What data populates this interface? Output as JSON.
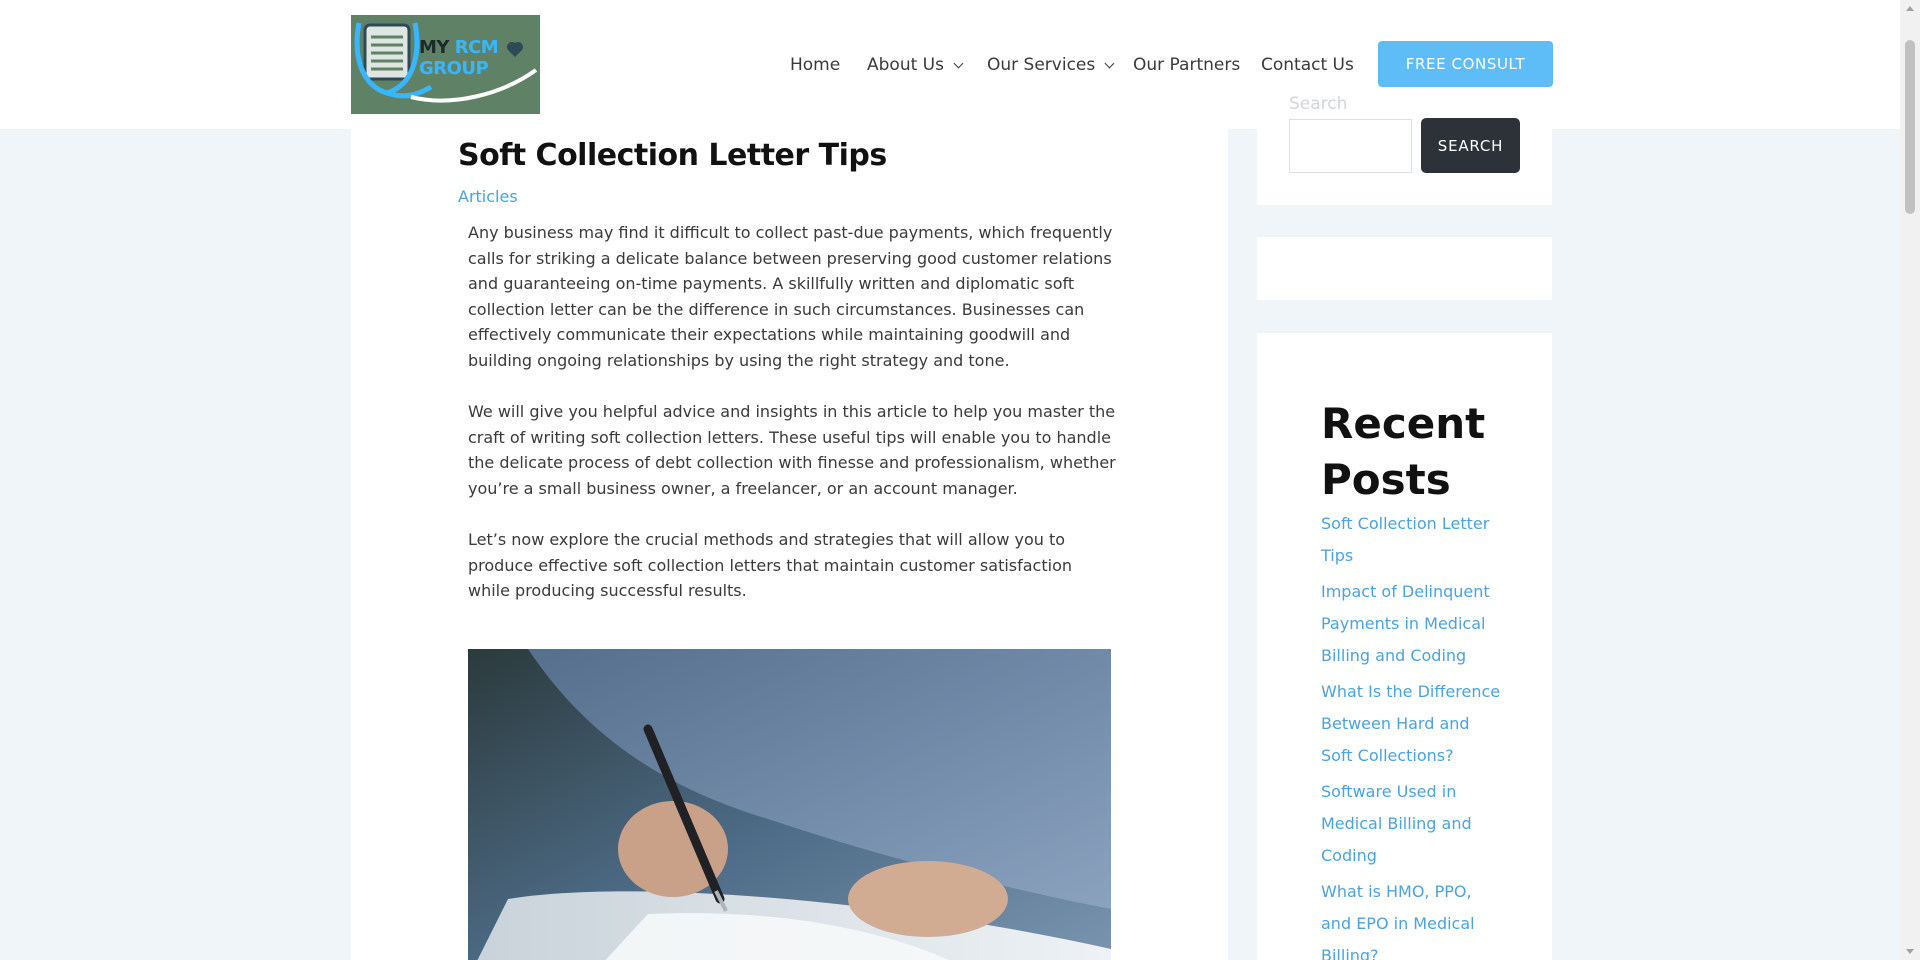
{
  "header": {
    "logo": {
      "line1_a": "MY",
      "line1_b": "RCM",
      "line2": "GROUP"
    },
    "nav": [
      {
        "label": "Home",
        "has_dropdown": false
      },
      {
        "label": "About Us",
        "has_dropdown": true
      },
      {
        "label": "Our Services",
        "has_dropdown": true
      },
      {
        "label": "Our Partners",
        "has_dropdown": false
      },
      {
        "label": "Contact Us",
        "has_dropdown": false
      }
    ],
    "cta_label": "FREE CONSULT",
    "cta_color": "#5ebdf6"
  },
  "article": {
    "title": "Soft Collection Letter Tips",
    "category": "Articles",
    "paragraphs": [
      "Any business may find it difficult to collect past-due payments, which frequently calls for striking a delicate balance between preserving good customer relations and guaranteeing on-time payments. A skillfully written and diplomatic soft collection letter can be the difference in such circumstances. Businesses can effectively communicate their expectations while maintaining goodwill and building ongoing relationships by using the right strategy and tone.",
      "We will give you helpful advice and insights in this article to help you master the craft of writing soft collection letters. These useful tips will enable you to handle the delicate process of debt collection with finesse and professionalism, whether you’re a small business owner, a freelancer, or an account manager.",
      "Let’s now explore the crucial methods and strategies that will allow you to produce effective soft collection letters that maintain customer satisfaction while producing successful results."
    ]
  },
  "sidebar": {
    "search": {
      "placeholder": "Search",
      "button_label": "SEARCH"
    },
    "recent_posts": {
      "heading": "Recent Posts",
      "items": [
        "Soft Collection Letter Tips",
        "Impact of Delinquent Payments in Medical Billing and Coding",
        "What Is the Difference Between Hard and Soft Collections?",
        "Software Used in Medical Billing and Coding",
        "What is HMO, PPO, and EPO in Medical Billing?"
      ]
    }
  },
  "colors": {
    "link": "#4aa3e0",
    "page_bg": "#f0f5fa",
    "search_button": "#2c3238",
    "logo_bg": "#5f8266"
  }
}
